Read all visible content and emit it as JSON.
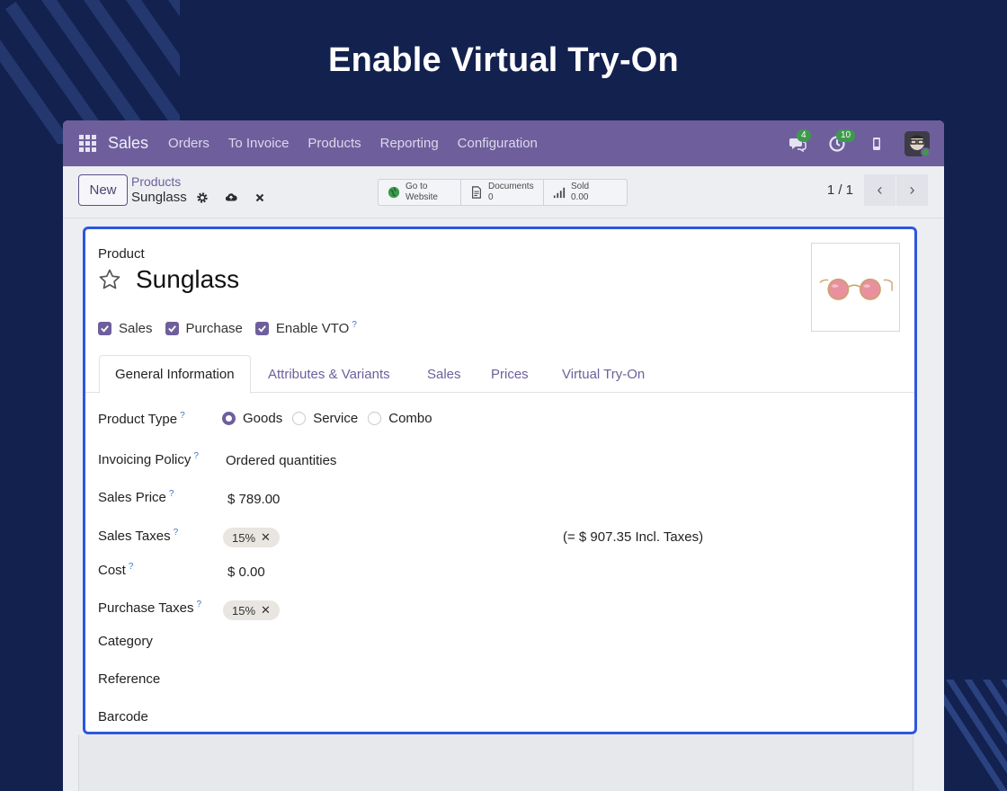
{
  "hero": {
    "title": "Enable Virtual Try-On"
  },
  "navbar": {
    "brand": "Sales",
    "menu": [
      "Orders",
      "To Invoice",
      "Products",
      "Reporting",
      "Configuration"
    ],
    "messages_count": "4",
    "activities_count": "10"
  },
  "control": {
    "new_label": "New",
    "breadcrumb_parent": "Products",
    "breadcrumb_current": "Sunglass",
    "smart_buttons": {
      "website_line1": "Go to",
      "website_line2": "Website",
      "documents_label": "Documents",
      "documents_count": "0",
      "sold_label": "Sold",
      "sold_value": "0.00"
    },
    "pager": "1 / 1"
  },
  "product": {
    "label": "Product",
    "name": "Sunglass",
    "checks": [
      {
        "label": "Sales",
        "checked": true
      },
      {
        "label": "Purchase",
        "checked": true
      },
      {
        "label": "Enable VTO",
        "checked": true,
        "help": "?"
      }
    ]
  },
  "tabs": [
    "General Information",
    "Attributes & Variants",
    "Sales",
    "Prices",
    "Virtual Try-On"
  ],
  "fields": {
    "product_type": {
      "label": "Product Type",
      "help": "?",
      "options": [
        "Goods",
        "Service",
        "Combo"
      ],
      "selected": "Goods"
    },
    "invoicing_policy": {
      "label": "Invoicing Policy",
      "help": "?",
      "value": "Ordered quantities"
    },
    "sales_price": {
      "label": "Sales Price",
      "help": "?",
      "value": "$ 789.00"
    },
    "sales_taxes": {
      "label": "Sales Taxes",
      "help": "?",
      "tag": "15%",
      "incl": "(= $ 907.35 Incl. Taxes)"
    },
    "cost": {
      "label": "Cost",
      "help": "?",
      "value": "$ 0.00"
    },
    "purchase_taxes": {
      "label": "Purchase Taxes",
      "help": "?",
      "tag": "15%"
    },
    "category": {
      "label": "Category"
    },
    "reference": {
      "label": "Reference"
    },
    "barcode": {
      "label": "Barcode"
    }
  },
  "colors": {
    "primary": "#6e5f9c",
    "highlight": "#2d56e0",
    "background": "#13214f"
  },
  "icons": [
    "apps-grid-icon",
    "chat-icon",
    "clock-icon",
    "phone-icon",
    "gear-icon",
    "cloud-upload-icon",
    "close-icon",
    "globe-icon",
    "document-icon",
    "signal-icon",
    "star-icon",
    "chevron-left-icon",
    "chevron-right-icon"
  ]
}
